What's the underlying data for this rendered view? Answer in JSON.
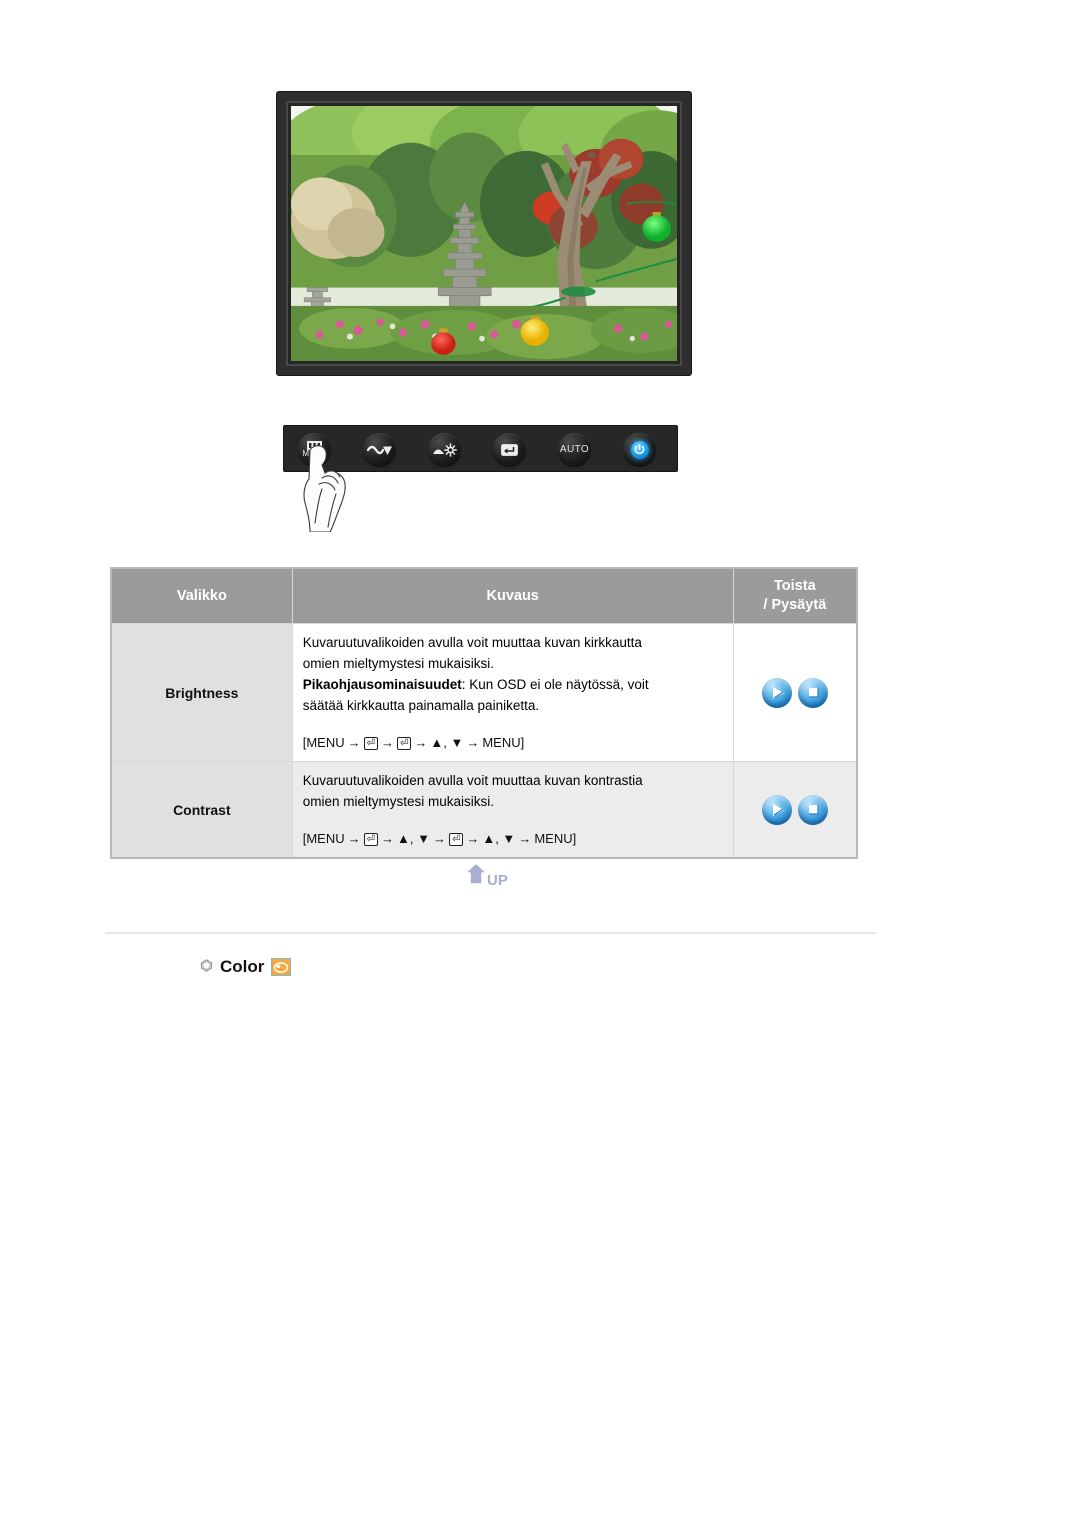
{
  "monitor": {
    "alt": "lcd-monitor-displaying-garden-photo",
    "screen_scene": "korean-garden-with-stone-pagoda-and-paper-lanterns"
  },
  "control_panel": {
    "buttons": [
      {
        "name": "menu-button",
        "label": "MENU",
        "icon": "menu-bars-icon"
      },
      {
        "name": "source-down-button",
        "label": "",
        "icon": "source-down-icon"
      },
      {
        "name": "brightness-button",
        "label": "",
        "icon": "brightness-sun-icon"
      },
      {
        "name": "enter-button",
        "label": "",
        "icon": "enter-key-icon"
      },
      {
        "name": "auto-button",
        "label": "AUTO",
        "icon": "auto-text-icon"
      },
      {
        "name": "power-button",
        "label": "",
        "icon": "power-icon"
      }
    ],
    "hand_cursor": "hand-pointing-at-menu-button"
  },
  "table": {
    "headers": {
      "menu": "Valikko",
      "description": "Kuvaus",
      "toista_line1": "Toista",
      "toista_line2": "/ Pysäytä"
    },
    "rows": [
      {
        "menu": "Brightness",
        "desc_line1": "Kuvaruutuvalikoiden avulla voit muuttaa kuvan kirkkautta",
        "desc_line2": "omien mieltymystesi mukaisiksi.",
        "desc_bold": "Pikaohjausominaisuudet",
        "desc_line3_rest": ": Kun OSD ei ole näytössä, voit",
        "desc_line4": "säätää kirkkautta painamalla painiketta.",
        "sequence": [
          "[MENU",
          "enter-key-icon",
          "enter-key-icon",
          "▲, ▼",
          "MENU]"
        ],
        "sequence_text": "[MENU → ⏎ → ⏎ → ▲, ▼ → MENU]",
        "toista": [
          "play-orb-icon",
          "pause-orb-icon"
        ]
      },
      {
        "menu": "Contrast",
        "desc_line1": "Kuvaruutuvalikoiden avulla voit muuttaa kuvan kontrastia",
        "desc_line2": "omien mieltymystesi mukaisiksi.",
        "desc_bold": "",
        "desc_line3_rest": "",
        "desc_line4": "",
        "sequence": [
          "[MENU",
          "enter-key-icon",
          "▲, ▼",
          "enter-key-icon",
          "▲, ▼",
          "MENU]"
        ],
        "sequence_text": "[MENU → ⏎ → ▲, ▼ → ⏎ → ▲, ▼ → MENU]",
        "toista": [
          "play-orb-icon",
          "pause-orb-icon"
        ]
      }
    ]
  },
  "up_button": {
    "label": "UP",
    "icon": "up-arrow-icon"
  },
  "color_section": {
    "label": "Color",
    "bullet_icon": "hexagon-bullet-icon",
    "swatch_icon": "color-palette-icon"
  },
  "colors": {
    "header_gray": "#9b9b9b",
    "menu_cell_gray": "#e0e0e0",
    "alt_row_gray": "#ececec",
    "table_border": "#b8b8b8",
    "orb_blue": "#2b8fd6",
    "swatch_orange": "#f4a93c",
    "power_blue": "#1da7f0",
    "panel_black": "#272727"
  },
  "marks": {
    "arrow": "→",
    "up_tri": "▲",
    "down_tri": "▼",
    "enter_glyph": "⏎"
  }
}
